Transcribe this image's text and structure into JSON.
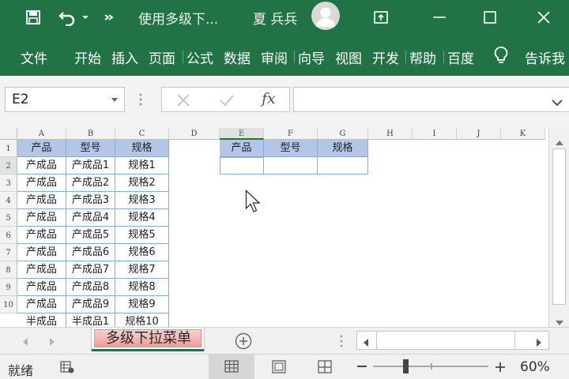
{
  "titlebar": {
    "doc_title": "使用多级下...",
    "user_name": "夏 兵兵",
    "color": "#217346"
  },
  "ribbon": {
    "tabs": [
      "文件",
      "开始",
      "插入",
      "页面",
      "公式",
      "数据",
      "审阅",
      "向导",
      "视图",
      "开发",
      "帮助",
      "百度",
      "告诉我"
    ]
  },
  "formula_bar": {
    "name_box": "E2",
    "fx_label": "fx",
    "formula": ""
  },
  "grid": {
    "columns": [
      "A",
      "B",
      "C",
      "D",
      "E",
      "F",
      "G",
      "H",
      "I",
      "J",
      "K"
    ],
    "rows": [
      "1",
      "2",
      "3",
      "4",
      "5",
      "6",
      "7",
      "8",
      "9",
      "10"
    ],
    "selected_cell": "E2",
    "source_table": {
      "headers": [
        "产品",
        "型号",
        "规格"
      ],
      "rows": [
        [
          "产成品",
          "产成品1",
          "规格1"
        ],
        [
          "产成品",
          "产成品2",
          "规格2"
        ],
        [
          "产成品",
          "产成品3",
          "规格3"
        ],
        [
          "产成品",
          "产成品4",
          "规格4"
        ],
        [
          "产成品",
          "产成品5",
          "规格5"
        ],
        [
          "产成品",
          "产成品6",
          "规格6"
        ],
        [
          "产成品",
          "产成品7",
          "规格7"
        ],
        [
          "产成品",
          "产成品8",
          "规格8"
        ],
        [
          "产成品",
          "产成品9",
          "规格9"
        ],
        [
          "半成品",
          "半成品1",
          "规格10"
        ]
      ]
    },
    "target_table": {
      "headers": [
        "产品",
        "型号",
        "规格"
      ]
    },
    "header_fill": "#b4c6e7",
    "border_color": "#8eaadb"
  },
  "sheets": {
    "active": "多级下拉菜单"
  },
  "statusbar": {
    "status": "就绪",
    "zoom": "60%"
  }
}
